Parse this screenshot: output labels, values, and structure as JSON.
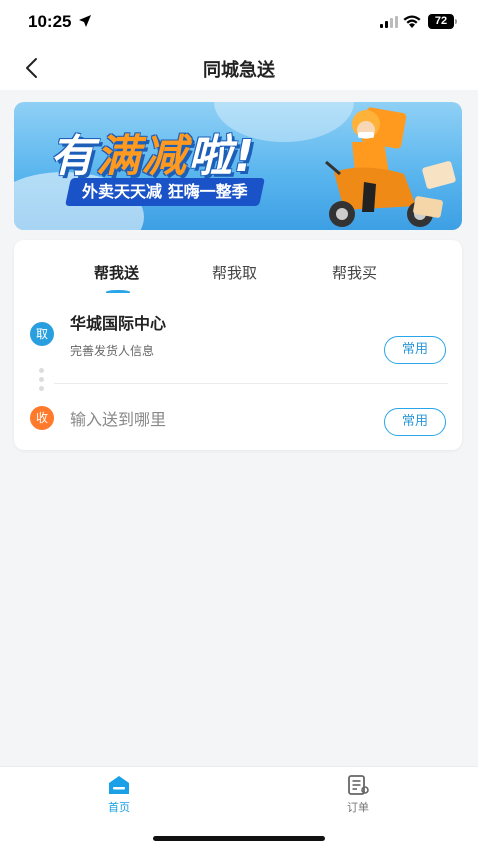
{
  "status_bar": {
    "time": "10:25",
    "battery": "72"
  },
  "nav": {
    "title": "同城急送"
  },
  "banner": {
    "headline_part1": "有",
    "headline_part2": "满减",
    "headline_part3": "啦!",
    "tagline": "外卖天天减 狂嗨一整季"
  },
  "tabs": [
    {
      "label": "帮我送",
      "active": true
    },
    {
      "label": "帮我取",
      "active": false
    },
    {
      "label": "帮我买",
      "active": false
    }
  ],
  "pickup": {
    "badge": "取",
    "address": "华城国际中心",
    "subtitle": "完善发货人信息",
    "button": "常用"
  },
  "delivery": {
    "badge": "收",
    "placeholder": "输入送到哪里",
    "button": "常用"
  },
  "tabbar": [
    {
      "label": "首页",
      "icon": "home-icon",
      "active": true
    },
    {
      "label": "订单",
      "icon": "orders-icon",
      "active": false
    }
  ],
  "colors": {
    "accent": "#2aa5e8",
    "pickup_badge": "#2a9fe0",
    "receive_badge": "#ff7a2b",
    "banner_bg": "#5bb6ee"
  }
}
